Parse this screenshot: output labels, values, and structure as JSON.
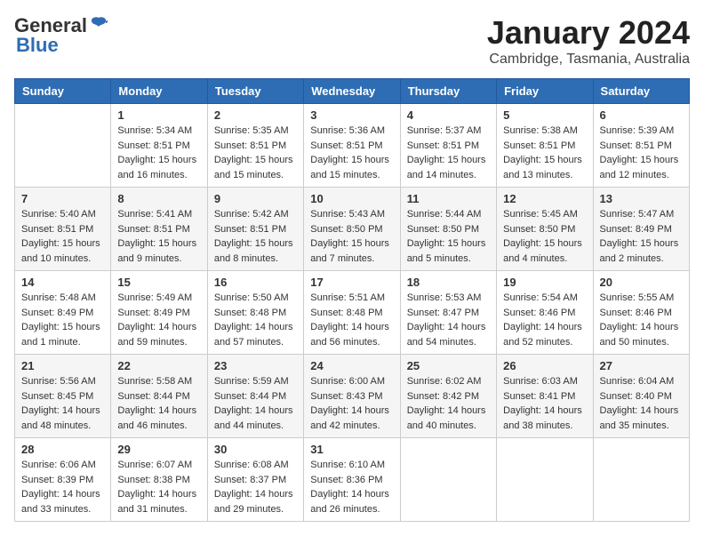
{
  "header": {
    "logo_general": "General",
    "logo_blue": "Blue",
    "month_title": "January 2024",
    "subtitle": "Cambridge, Tasmania, Australia"
  },
  "days_of_week": [
    "Sunday",
    "Monday",
    "Tuesday",
    "Wednesday",
    "Thursday",
    "Friday",
    "Saturday"
  ],
  "weeks": [
    [
      {
        "day": "",
        "info": ""
      },
      {
        "day": "1",
        "info": "Sunrise: 5:34 AM\nSunset: 8:51 PM\nDaylight: 15 hours\nand 16 minutes."
      },
      {
        "day": "2",
        "info": "Sunrise: 5:35 AM\nSunset: 8:51 PM\nDaylight: 15 hours\nand 15 minutes."
      },
      {
        "day": "3",
        "info": "Sunrise: 5:36 AM\nSunset: 8:51 PM\nDaylight: 15 hours\nand 15 minutes."
      },
      {
        "day": "4",
        "info": "Sunrise: 5:37 AM\nSunset: 8:51 PM\nDaylight: 15 hours\nand 14 minutes."
      },
      {
        "day": "5",
        "info": "Sunrise: 5:38 AM\nSunset: 8:51 PM\nDaylight: 15 hours\nand 13 minutes."
      },
      {
        "day": "6",
        "info": "Sunrise: 5:39 AM\nSunset: 8:51 PM\nDaylight: 15 hours\nand 12 minutes."
      }
    ],
    [
      {
        "day": "7",
        "info": "Sunrise: 5:40 AM\nSunset: 8:51 PM\nDaylight: 15 hours\nand 10 minutes."
      },
      {
        "day": "8",
        "info": "Sunrise: 5:41 AM\nSunset: 8:51 PM\nDaylight: 15 hours\nand 9 minutes."
      },
      {
        "day": "9",
        "info": "Sunrise: 5:42 AM\nSunset: 8:51 PM\nDaylight: 15 hours\nand 8 minutes."
      },
      {
        "day": "10",
        "info": "Sunrise: 5:43 AM\nSunset: 8:50 PM\nDaylight: 15 hours\nand 7 minutes."
      },
      {
        "day": "11",
        "info": "Sunrise: 5:44 AM\nSunset: 8:50 PM\nDaylight: 15 hours\nand 5 minutes."
      },
      {
        "day": "12",
        "info": "Sunrise: 5:45 AM\nSunset: 8:50 PM\nDaylight: 15 hours\nand 4 minutes."
      },
      {
        "day": "13",
        "info": "Sunrise: 5:47 AM\nSunset: 8:49 PM\nDaylight: 15 hours\nand 2 minutes."
      }
    ],
    [
      {
        "day": "14",
        "info": "Sunrise: 5:48 AM\nSunset: 8:49 PM\nDaylight: 15 hours\nand 1 minute."
      },
      {
        "day": "15",
        "info": "Sunrise: 5:49 AM\nSunset: 8:49 PM\nDaylight: 14 hours\nand 59 minutes."
      },
      {
        "day": "16",
        "info": "Sunrise: 5:50 AM\nSunset: 8:48 PM\nDaylight: 14 hours\nand 57 minutes."
      },
      {
        "day": "17",
        "info": "Sunrise: 5:51 AM\nSunset: 8:48 PM\nDaylight: 14 hours\nand 56 minutes."
      },
      {
        "day": "18",
        "info": "Sunrise: 5:53 AM\nSunset: 8:47 PM\nDaylight: 14 hours\nand 54 minutes."
      },
      {
        "day": "19",
        "info": "Sunrise: 5:54 AM\nSunset: 8:46 PM\nDaylight: 14 hours\nand 52 minutes."
      },
      {
        "day": "20",
        "info": "Sunrise: 5:55 AM\nSunset: 8:46 PM\nDaylight: 14 hours\nand 50 minutes."
      }
    ],
    [
      {
        "day": "21",
        "info": "Sunrise: 5:56 AM\nSunset: 8:45 PM\nDaylight: 14 hours\nand 48 minutes."
      },
      {
        "day": "22",
        "info": "Sunrise: 5:58 AM\nSunset: 8:44 PM\nDaylight: 14 hours\nand 46 minutes."
      },
      {
        "day": "23",
        "info": "Sunrise: 5:59 AM\nSunset: 8:44 PM\nDaylight: 14 hours\nand 44 minutes."
      },
      {
        "day": "24",
        "info": "Sunrise: 6:00 AM\nSunset: 8:43 PM\nDaylight: 14 hours\nand 42 minutes."
      },
      {
        "day": "25",
        "info": "Sunrise: 6:02 AM\nSunset: 8:42 PM\nDaylight: 14 hours\nand 40 minutes."
      },
      {
        "day": "26",
        "info": "Sunrise: 6:03 AM\nSunset: 8:41 PM\nDaylight: 14 hours\nand 38 minutes."
      },
      {
        "day": "27",
        "info": "Sunrise: 6:04 AM\nSunset: 8:40 PM\nDaylight: 14 hours\nand 35 minutes."
      }
    ],
    [
      {
        "day": "28",
        "info": "Sunrise: 6:06 AM\nSunset: 8:39 PM\nDaylight: 14 hours\nand 33 minutes."
      },
      {
        "day": "29",
        "info": "Sunrise: 6:07 AM\nSunset: 8:38 PM\nDaylight: 14 hours\nand 31 minutes."
      },
      {
        "day": "30",
        "info": "Sunrise: 6:08 AM\nSunset: 8:37 PM\nDaylight: 14 hours\nand 29 minutes."
      },
      {
        "day": "31",
        "info": "Sunrise: 6:10 AM\nSunset: 8:36 PM\nDaylight: 14 hours\nand 26 minutes."
      },
      {
        "day": "",
        "info": ""
      },
      {
        "day": "",
        "info": ""
      },
      {
        "day": "",
        "info": ""
      }
    ]
  ]
}
